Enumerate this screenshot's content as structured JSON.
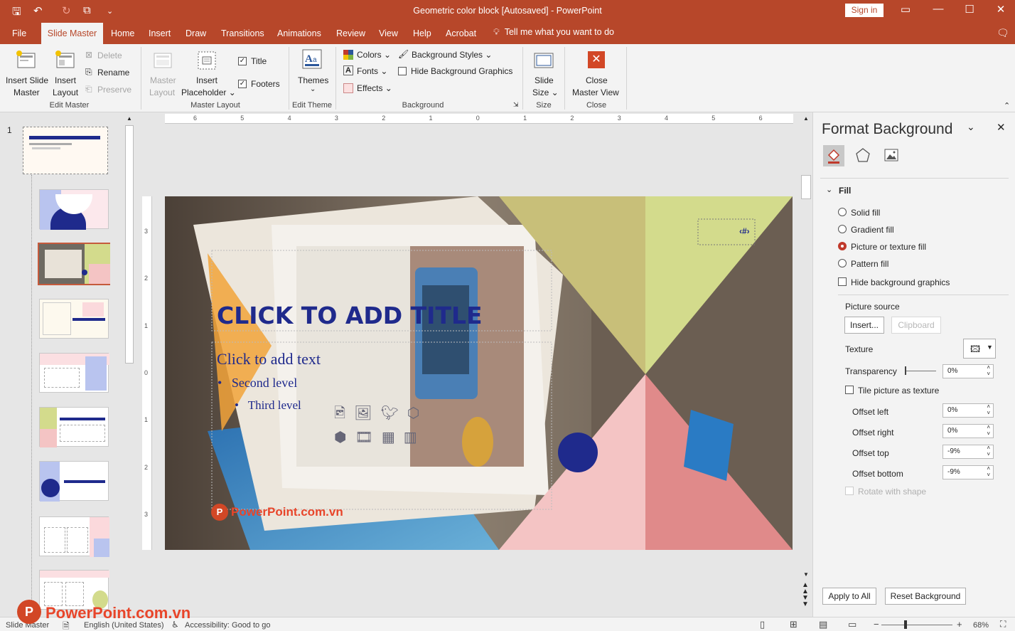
{
  "title_bar": {
    "document_title": "Geometric color block [Autosaved]  -  PowerPoint",
    "sign_in": "Sign in"
  },
  "tabs": [
    "File",
    "Slide Master",
    "Home",
    "Insert",
    "Draw",
    "Transitions",
    "Animations",
    "Review",
    "View",
    "Help",
    "Acrobat"
  ],
  "tell_me": "Tell me what you want to do",
  "ribbon": {
    "edit_master": {
      "insert_slide_master": [
        "Insert Slide",
        "Master"
      ],
      "insert_layout": [
        "Insert",
        "Layout"
      ],
      "delete": "Delete",
      "rename": "Rename",
      "preserve": "Preserve",
      "label": "Edit Master"
    },
    "master_layout": {
      "master_layout": [
        "Master",
        "Layout"
      ],
      "insert_placeholder": [
        "Insert",
        "Placeholder"
      ],
      "title": "Title",
      "footers": "Footers",
      "label": "Master Layout"
    },
    "edit_theme": {
      "themes": "Themes",
      "label": "Edit Theme"
    },
    "background": {
      "colors": "Colors",
      "fonts": "Fonts",
      "effects": "Effects",
      "background_styles": "Background Styles",
      "hide_background_graphics": "Hide Background Graphics",
      "label": "Background"
    },
    "size": {
      "slide_size": [
        "Slide",
        "Size"
      ],
      "label": "Size"
    },
    "close": {
      "close_master_view": [
        "Close",
        "Master View"
      ],
      "label": "Close"
    }
  },
  "thumbnail_number": "1",
  "ruler_h": [
    "6",
    "5",
    "4",
    "3",
    "2",
    "1",
    "0",
    "1",
    "2",
    "3",
    "4",
    "5",
    "6"
  ],
  "ruler_v": [
    "3",
    "2",
    "1",
    "0",
    "1",
    "2",
    "3"
  ],
  "slide": {
    "title": "CLICK TO ADD TITLE",
    "body": "Click to add text",
    "level2": "Second level",
    "level3": "Third level",
    "number": "‹#›",
    "watermark": "PowerPoint.com.vn"
  },
  "pane": {
    "title": "Format Background",
    "fill_header": "Fill",
    "solid": "Solid fill",
    "gradient": "Gradient fill",
    "picture": "Picture or texture fill",
    "pattern": "Pattern fill",
    "hide_bg": "Hide background graphics",
    "picture_source": "Picture source",
    "insert": "Insert...",
    "clipboard": "Clipboard",
    "texture": "Texture",
    "transparency": "Transparency",
    "transparency_value": "0%",
    "tile": "Tile picture as texture",
    "offset_left": "Offset left",
    "offset_left_value": "0%",
    "offset_right": "Offset right",
    "offset_right_value": "0%",
    "offset_top": "Offset top",
    "offset_top_value": "-9%",
    "offset_bottom": "Offset bottom",
    "offset_bottom_value": "-9%",
    "rotate": "Rotate with shape",
    "apply_all": "Apply to All",
    "reset": "Reset Background"
  },
  "status": {
    "view": "Slide Master",
    "language": "English (United States)",
    "accessibility": "Accessibility: Good to go",
    "zoom": "68%"
  },
  "colors": {
    "accent": "#b7472a",
    "navy": "#1f2a8c",
    "olive": "#c8bf79",
    "lime": "#d3db8c",
    "pink": "#f4c4c4",
    "rose": "#e08a8a"
  }
}
